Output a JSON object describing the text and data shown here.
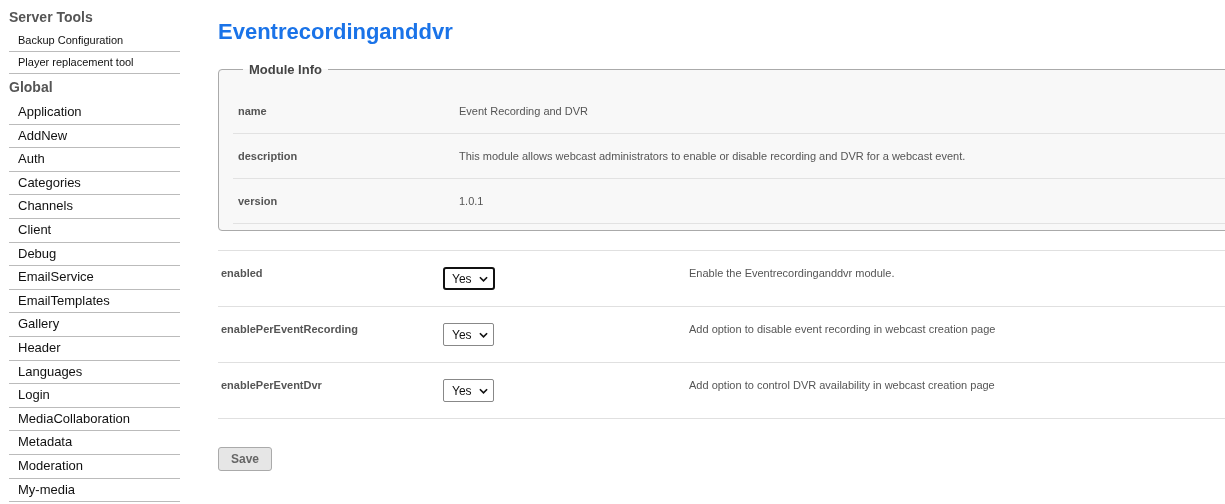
{
  "sidebar": {
    "sections": [
      {
        "title": "Server Tools",
        "kind": "tools",
        "items": [
          "Backup Configuration",
          "Player replacement tool"
        ]
      },
      {
        "title": "Global",
        "kind": "modules",
        "items": [
          "Application",
          "AddNew",
          "Auth",
          "Categories",
          "Channels",
          "Client",
          "Debug",
          "EmailService",
          "EmailTemplates",
          "Gallery",
          "Header",
          "Languages",
          "Login",
          "MediaCollaboration",
          "Metadata",
          "Moderation",
          "My-media"
        ]
      }
    ]
  },
  "page_title": "Eventrecordinganddvr",
  "module_info": {
    "legend": "Module Info",
    "rows": [
      {
        "label": "name",
        "value": "Event Recording and DVR"
      },
      {
        "label": "description",
        "value": "This module allows webcast administrators to enable or disable recording and DVR for a webcast event."
      },
      {
        "label": "version",
        "value": "1.0.1"
      }
    ]
  },
  "settings": [
    {
      "label": "enabled",
      "value": "Yes",
      "focused": true,
      "help": "Enable the Eventrecordinganddvr module."
    },
    {
      "label": "enablePerEventRecording",
      "value": "Yes",
      "focused": false,
      "help": "Add option to disable event recording in webcast creation page"
    },
    {
      "label": "enablePerEventDvr",
      "value": "Yes",
      "focused": false,
      "help": "Add option to control DVR availability in webcast creation page"
    }
  ],
  "save_button": "Save"
}
